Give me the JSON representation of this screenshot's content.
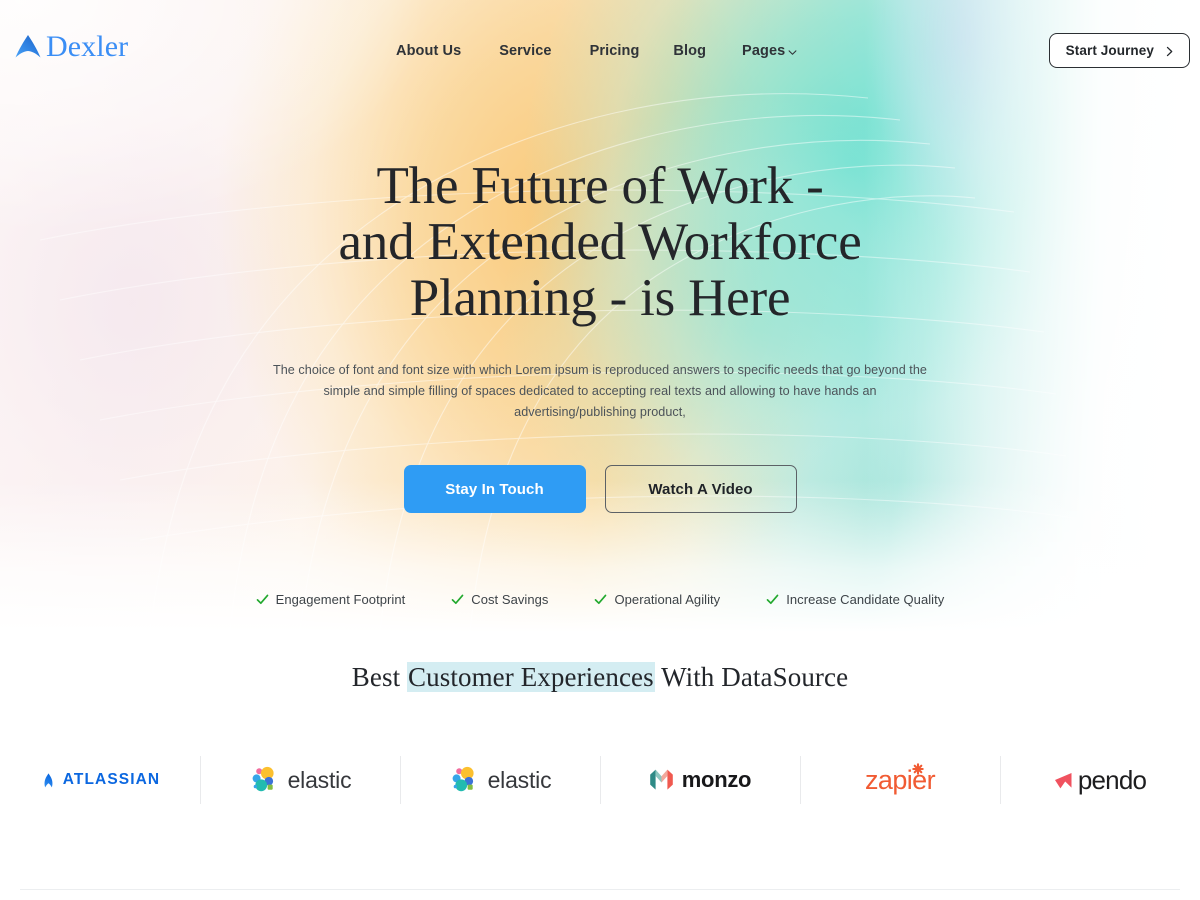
{
  "brand": {
    "name": "Dexler",
    "mark_icon": "dexler-arrow-icon",
    "accent_color": "#3b8ef5"
  },
  "nav": {
    "items": [
      {
        "label": "About Us",
        "has_dropdown": false
      },
      {
        "label": "Service",
        "has_dropdown": false
      },
      {
        "label": "Pricing",
        "has_dropdown": false
      },
      {
        "label": "Blog",
        "has_dropdown": false
      },
      {
        "label": "Pages",
        "has_dropdown": true
      }
    ]
  },
  "header": {
    "cta_label": "Start Journey",
    "cta_icon": "chevron-right-icon"
  },
  "hero": {
    "title_lines": [
      "The Future of Work -",
      "and Extended Workforce",
      "Planning - is Here"
    ],
    "subtitle": "The choice of font and font size with which Lorem ipsum is reproduced answers to specific needs that go beyond the simple and simple filling of spaces dedicated to accepting real texts and allowing to have hands an advertising/publishing product,",
    "primary_cta": "Stay In Touch",
    "secondary_cta": "Watch A Video",
    "primary_cta_color": "#2f9cf4",
    "features": [
      "Engagement Footprint",
      "Cost Savings",
      "Operational Agility",
      "Increase Candidate Quality"
    ],
    "check_color": "#22a92e"
  },
  "clients": {
    "title_before": "Best ",
    "title_highlight": "Customer Experiences",
    "title_after": " With DataSource",
    "highlight_color": "#d4edf2",
    "logos": [
      {
        "name": "Atlassian",
        "wordmark": "ATLASSIAN",
        "color": "#0b67e0"
      },
      {
        "name": "elastic",
        "wordmark": "elastic",
        "color": "#36383c"
      },
      {
        "name": "elastic",
        "wordmark": "elastic",
        "color": "#36383c"
      },
      {
        "name": "monzo",
        "wordmark": "monzo",
        "color": "#18181a"
      },
      {
        "name": "zapier",
        "wordmark": "zapier",
        "color": "#f15b33"
      },
      {
        "name": "pendo",
        "wordmark": "pendo",
        "color": "#1d1d1f"
      }
    ]
  }
}
